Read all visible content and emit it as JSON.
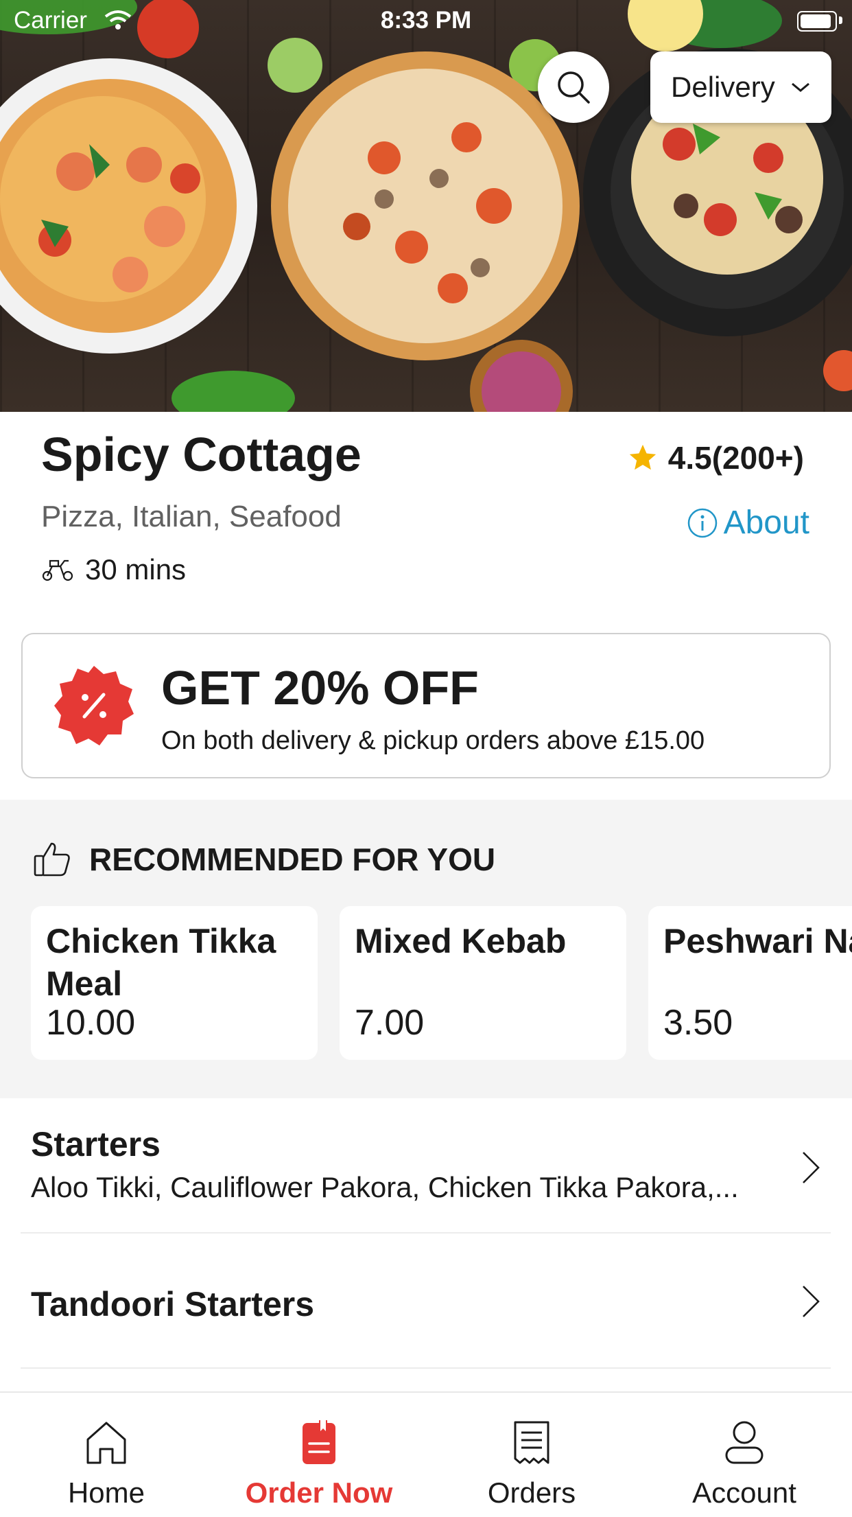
{
  "status_bar": {
    "carrier": "Carrier",
    "time": "8:33 PM"
  },
  "header": {
    "mode_label": "Delivery",
    "search_icon": "search-icon",
    "dropdown_icon": "chevron-down-icon"
  },
  "restaurant": {
    "name": "Spicy Cottage",
    "rating": "4.5(200+)",
    "cuisines": "Pizza, Italian, Seafood",
    "about_label": "About",
    "delivery_time": "30 mins"
  },
  "offer": {
    "headline": "GET 20% OFF",
    "description": "On both delivery & pickup orders above £15.00",
    "badge_icon": "percent-badge-icon",
    "badge_color": "#e53935"
  },
  "recommended": {
    "title": "RECOMMENDED FOR YOU",
    "items": [
      {
        "name": "Chicken Tikka Meal",
        "price": "10.00"
      },
      {
        "name": "Mixed Kebab",
        "price": "7.00"
      },
      {
        "name": "Peshwari Na",
        "price": "3.50"
      }
    ]
  },
  "categories": [
    {
      "name": "Starters",
      "description": "Aloo Tikki, Cauliflower Pakora, Chicken Tikka Pakora,..."
    },
    {
      "name": "Tandoori Starters",
      "description": ""
    }
  ],
  "tabs": [
    {
      "label": "Home",
      "icon": "home-icon"
    },
    {
      "label": "Order Now",
      "icon": "order-now-icon"
    },
    {
      "label": "Orders",
      "icon": "receipt-icon"
    },
    {
      "label": "Account",
      "icon": "user-icon"
    }
  ],
  "colors": {
    "accent": "#e53935",
    "link": "#2196c8",
    "star": "#f5b400"
  }
}
